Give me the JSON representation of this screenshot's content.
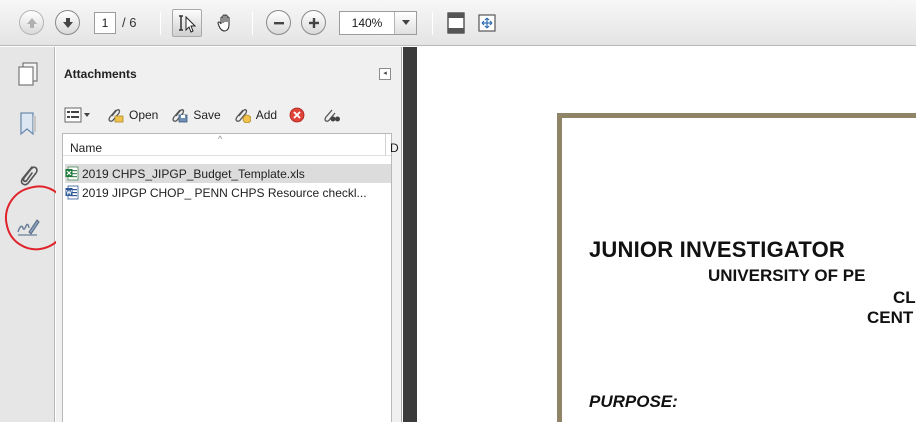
{
  "toolbar": {
    "page_current": "1",
    "page_total": "/ 6",
    "zoom_value": "140%",
    "icons": [
      "arrow-up-icon",
      "arrow-down-icon",
      "select-text-icon",
      "hand-icon",
      "zoom-out-icon",
      "zoom-in-icon",
      "fit-page-icon",
      "fit-width-icon"
    ]
  },
  "rail": {
    "icons": [
      "pages-icon",
      "bookmark-icon",
      "paperclip-icon",
      "signature-icon"
    ]
  },
  "panel": {
    "title": "Attachments",
    "collapse_glyph": "◂",
    "buttons": {
      "open": "Open",
      "save": "Save",
      "add": "Add"
    },
    "column_name": "Name",
    "column_second": "D",
    "sort_glyph": "^",
    "files": [
      {
        "name": "2019 CHPS_JIPGP_Budget_Template.xls",
        "type": "excel"
      },
      {
        "name": "2019 JIPGP CHOP_ PENN CHPS Resource checkl...",
        "type": "word"
      }
    ]
  },
  "document": {
    "line1": "JUNIOR INVESTIGATOR",
    "line2": "UNIVERSITY OF PE",
    "line3": "CL",
    "line4": "CENT",
    "line5": "PURPOSE:",
    "frame_color": "#8f8566"
  },
  "colors": {
    "annotation_red": "#e0232b",
    "excel_green": "#1f7a3a",
    "word_blue": "#2b5797"
  }
}
